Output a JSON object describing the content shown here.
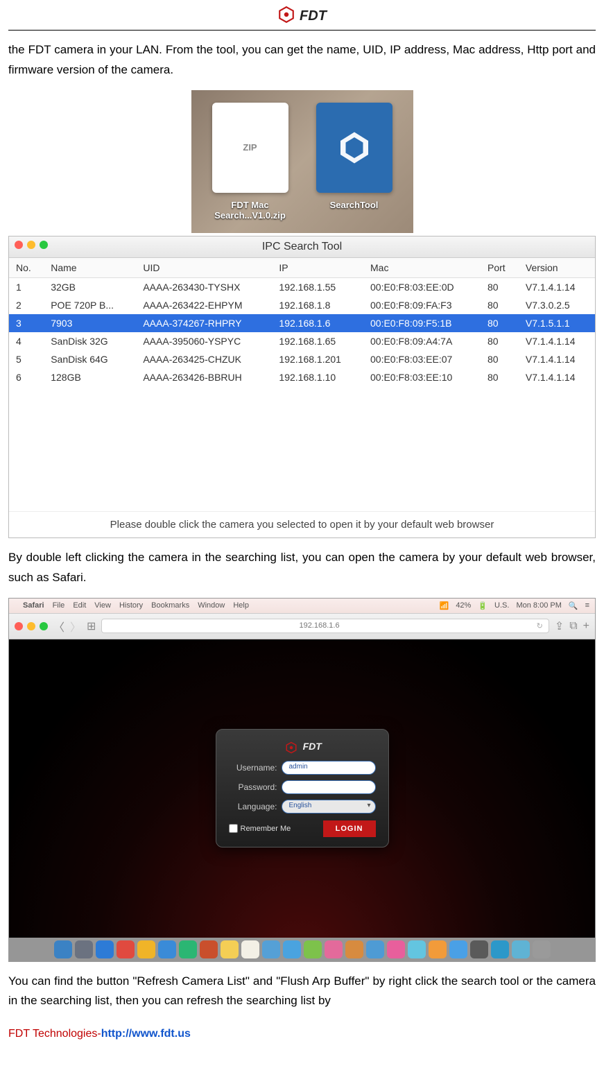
{
  "header": {
    "brand": "FDT"
  },
  "paragraphs": {
    "p1": "the FDT camera in your LAN. From the tool, you can get the name, UID, IP address, Mac address, Http port and firmware version of the camera.",
    "p2": "By double left clicking the camera in the searching list, you can open the camera by your default web browser, such as Safari.",
    "p3": "You can find the button \"Refresh Camera List\" and \"Flush Arp Buffer\" by right click the search tool or the camera in the searching list, then you can refresh the searching list by"
  },
  "desktop": {
    "zip_label": "FDT Mac\nSearch...V1.0.zip",
    "tool_label": "SearchTool"
  },
  "ipc": {
    "title": "IPC Search Tool",
    "headers": {
      "no": "No.",
      "name": "Name",
      "uid": "UID",
      "ip": "IP",
      "mac": "Mac",
      "port": "Port",
      "version": "Version"
    },
    "rows": [
      {
        "no": "1",
        "name": "32GB",
        "uid": "AAAA-263430-TYSHX",
        "ip": "192.168.1.55",
        "mac": "00:E0:F8:03:EE:0D",
        "port": "80",
        "version": "V7.1.4.1.14",
        "selected": false
      },
      {
        "no": "2",
        "name": "POE 720P B...",
        "uid": "AAAA-263422-EHPYM",
        "ip": "192.168.1.8",
        "mac": "00:E0:F8:09:FA:F3",
        "port": "80",
        "version": "V7.3.0.2.5",
        "selected": false
      },
      {
        "no": "3",
        "name": "7903",
        "uid": "AAAA-374267-RHPRY",
        "ip": "192.168.1.6",
        "mac": "00:E0:F8:09:F5:1B",
        "port": "80",
        "version": "V7.1.5.1.1",
        "selected": true
      },
      {
        "no": "4",
        "name": "SanDisk 32G",
        "uid": "AAAA-395060-YSPYC",
        "ip": "192.168.1.65",
        "mac": "00:E0:F8:09:A4:7A",
        "port": "80",
        "version": "V7.1.4.1.14",
        "selected": false
      },
      {
        "no": "5",
        "name": "SanDisk 64G",
        "uid": "AAAA-263425-CHZUK",
        "ip": "192.168.1.201",
        "mac": "00:E0:F8:03:EE:07",
        "port": "80",
        "version": "V7.1.4.1.14",
        "selected": false
      },
      {
        "no": "6",
        "name": "128GB",
        "uid": "AAAA-263426-BBRUH",
        "ip": "192.168.1.10",
        "mac": "00:E0:F8:03:EE:10",
        "port": "80",
        "version": "V7.1.4.1.14",
        "selected": false
      }
    ],
    "hint": "Please double click the camera you selected to open it by your default web browser"
  },
  "safari": {
    "menu": {
      "apple": "",
      "app": "Safari",
      "items": [
        "File",
        "Edit",
        "View",
        "History",
        "Bookmarks",
        "Window",
        "Help"
      ],
      "battery": "42%",
      "locale": "U.S.",
      "clock": "Mon 8:00 PM"
    },
    "url": "192.168.1.6",
    "login": {
      "brand": "FDT",
      "username_label": "Username:",
      "username_value": "admin",
      "password_label": "Password:",
      "language_label": "Language:",
      "language_value": "English",
      "remember_label": "Remember Me",
      "login_button": "LOGIN"
    }
  },
  "footer": {
    "company": "FDT Technologies-",
    "url": "http://www.fdt.us"
  },
  "dock_colors": [
    "#3b82c4",
    "#6b7280",
    "#2d7bd6",
    "#e04a3f",
    "#f0b428",
    "#3a8bd8",
    "#2bb673",
    "#c94f2c",
    "#f4ce55",
    "#f3f0e6",
    "#55a0d6",
    "#4aa3df",
    "#7dc24b",
    "#e36a9b",
    "#d78b3f",
    "#4e9bd4",
    "#e85f9c",
    "#63c5e0",
    "#f29b3a",
    "#4aa0e6",
    "#5a5a5a",
    "#2c98c9",
    "#5fb3d4",
    "#9a9a9a"
  ]
}
